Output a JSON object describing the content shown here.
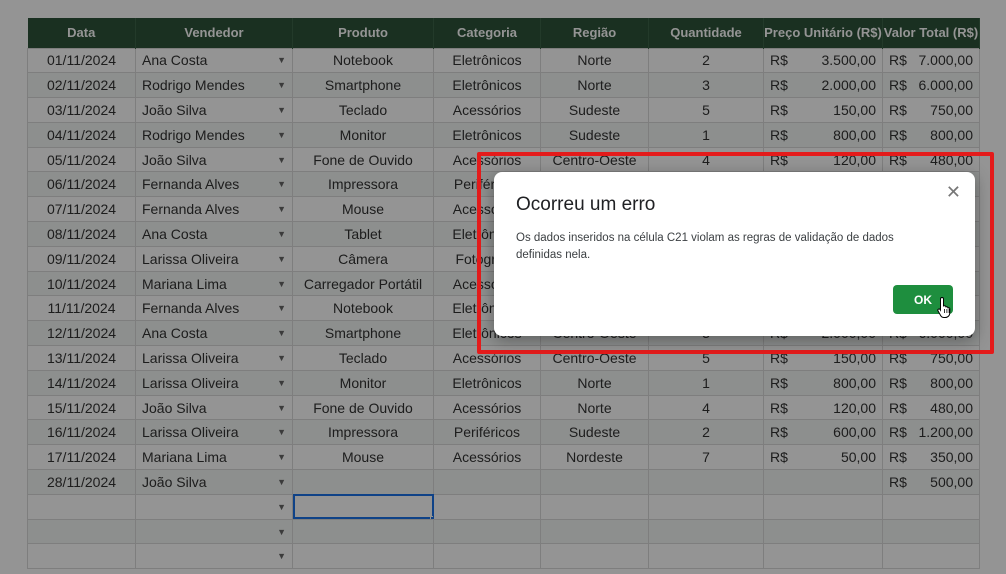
{
  "headers": [
    "Data",
    "Vendedor",
    "Produto",
    "Categoria",
    "Região",
    "Quantidade",
    "Preço Unitário (R$)",
    "Valor Total (R$)"
  ],
  "currency": "R$",
  "rows": [
    {
      "data": "01/11/2024",
      "vendedor": "Ana Costa",
      "produto": "Notebook",
      "categoria": "Eletrônicos",
      "regiao": "Norte",
      "qtd": "2",
      "preco": "3.500,00",
      "total": "7.000,00"
    },
    {
      "data": "02/11/2024",
      "vendedor": "Rodrigo Mendes",
      "produto": "Smartphone",
      "categoria": "Eletrônicos",
      "regiao": "Norte",
      "qtd": "3",
      "preco": "2.000,00",
      "total": "6.000,00"
    },
    {
      "data": "03/11/2024",
      "vendedor": "João Silva",
      "produto": "Teclado",
      "categoria": "Acessórios",
      "regiao": "Sudeste",
      "qtd": "5",
      "preco": "150,00",
      "total": "750,00"
    },
    {
      "data": "04/11/2024",
      "vendedor": "Rodrigo Mendes",
      "produto": "Monitor",
      "categoria": "Eletrônicos",
      "regiao": "Sudeste",
      "qtd": "1",
      "preco": "800,00",
      "total": "800,00"
    },
    {
      "data": "05/11/2024",
      "vendedor": "João Silva",
      "produto": "Fone de Ouvido",
      "categoria": "Acessórios",
      "regiao": "Centro-Oeste",
      "qtd": "4",
      "preco": "120,00",
      "total": "480,00"
    },
    {
      "data": "06/11/2024",
      "vendedor": "Fernanda Alves",
      "produto": "Impressora",
      "categoria": "Periféricos",
      "regiao": "",
      "qtd": "",
      "preco": "",
      "total": ""
    },
    {
      "data": "07/11/2024",
      "vendedor": "Fernanda Alves",
      "produto": "Mouse",
      "categoria": "Acessórios",
      "regiao": "",
      "qtd": "",
      "preco": "",
      "total": ""
    },
    {
      "data": "08/11/2024",
      "vendedor": "Ana Costa",
      "produto": "Tablet",
      "categoria": "Eletrônicos",
      "regiao": "",
      "qtd": "",
      "preco": "",
      "total": ""
    },
    {
      "data": "09/11/2024",
      "vendedor": "Larissa Oliveira",
      "produto": "Câmera",
      "categoria": "Fotografia",
      "regiao": "",
      "qtd": "",
      "preco": "",
      "total": ""
    },
    {
      "data": "10/11/2024",
      "vendedor": "Mariana Lima",
      "produto": "Carregador Portátil",
      "categoria": "Acessórios",
      "regiao": "",
      "qtd": "",
      "preco": "",
      "total": ""
    },
    {
      "data": "11/11/2024",
      "vendedor": "Fernanda Alves",
      "produto": "Notebook",
      "categoria": "Eletrônicos",
      "regiao": "",
      "qtd": "",
      "preco": "",
      "total": ""
    },
    {
      "data": "12/11/2024",
      "vendedor": "Ana Costa",
      "produto": "Smartphone",
      "categoria": "Eletrônicos",
      "regiao": "Centro-Oeste",
      "qtd": "3",
      "preco": "2.000,00",
      "total": "6.000,00"
    },
    {
      "data": "13/11/2024",
      "vendedor": "Larissa Oliveira",
      "produto": "Teclado",
      "categoria": "Acessórios",
      "regiao": "Centro-Oeste",
      "qtd": "5",
      "preco": "150,00",
      "total": "750,00"
    },
    {
      "data": "14/11/2024",
      "vendedor": "Larissa Oliveira",
      "produto": "Monitor",
      "categoria": "Eletrônicos",
      "regiao": "Norte",
      "qtd": "1",
      "preco": "800,00",
      "total": "800,00"
    },
    {
      "data": "15/11/2024",
      "vendedor": "João Silva",
      "produto": "Fone de Ouvido",
      "categoria": "Acessórios",
      "regiao": "Norte",
      "qtd": "4",
      "preco": "120,00",
      "total": "480,00"
    },
    {
      "data": "16/11/2024",
      "vendedor": "Larissa Oliveira",
      "produto": "Impressora",
      "categoria": "Periféricos",
      "regiao": "Sudeste",
      "qtd": "2",
      "preco": "600,00",
      "total": "1.200,00"
    },
    {
      "data": "17/11/2024",
      "vendedor": "Mariana Lima",
      "produto": "Mouse",
      "categoria": "Acessórios",
      "regiao": "Nordeste",
      "qtd": "7",
      "preco": "50,00",
      "total": "350,00"
    },
    {
      "data": "28/11/2024",
      "vendedor": "João Silva",
      "produto": "",
      "categoria": "",
      "regiao": "",
      "qtd": "",
      "preco": "",
      "total": "500,00"
    },
    {
      "data": "",
      "vendedor": "",
      "produto": "",
      "categoria": "",
      "regiao": "",
      "qtd": "",
      "preco": "",
      "total": ""
    },
    {
      "data": "",
      "vendedor": "",
      "produto": "",
      "categoria": "",
      "regiao": "",
      "qtd": "",
      "preco": "",
      "total": ""
    },
    {
      "data": "",
      "vendedor": "",
      "produto": "",
      "categoria": "",
      "regiao": "",
      "qtd": "",
      "preco": "",
      "total": ""
    }
  ],
  "selected_row_index": 18,
  "dialog": {
    "title": "Ocorreu um erro",
    "message": "Os dados inseridos na célula C21 violam as regras de validação de dados definidas nela.",
    "ok_label": "OK",
    "close_icon": "close-icon"
  },
  "colors": {
    "header_bg": "#2e5339",
    "ok_button": "#1e8e3e",
    "highlight": "#e41b1b",
    "selection": "#1a73e8"
  }
}
